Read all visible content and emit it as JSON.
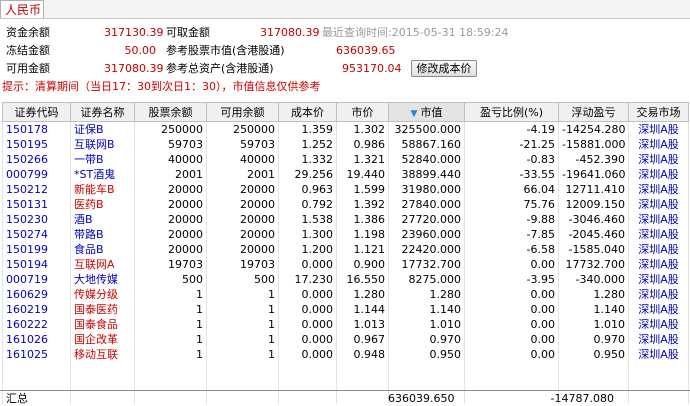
{
  "tab": {
    "label": "人民币"
  },
  "summary": {
    "balance_label": "资金余额",
    "balance": "317130.39",
    "withdrawable_label": "可取金额",
    "withdrawable": "317080.39",
    "last_query": "最近查询时间:2015-05-31 18:59:24",
    "frozen_label": "冻结金额",
    "frozen": "50.00",
    "ref_value_label": "参考股票市值(含港股通)",
    "ref_value": "636039.65",
    "available_label": "可用金额",
    "available": "317080.39",
    "total_assets_label": "参考总资产(含港股通)",
    "total_assets": "953170.04",
    "change_cost_button": "修改成本价"
  },
  "hint": "提示：清算期间（当日17：30到次日1：30），市值信息仅供参考",
  "table": {
    "headers": [
      "证券代码",
      "证券名称",
      "股票余额",
      "可用余额",
      "成本价",
      "市价",
      "市值",
      "盈亏比例(%)",
      "浮动盈亏",
      "交易市场"
    ],
    "rows": [
      [
        "150178",
        "证保B",
        "250000",
        "250000",
        "1.359",
        "1.302",
        "325500.000",
        "-4.19",
        "-14254.280",
        "深圳A股"
      ],
      [
        "150195",
        "互联网B",
        "59703",
        "59703",
        "1.252",
        "0.986",
        "58867.160",
        "-21.25",
        "-15881.000",
        "深圳A股"
      ],
      [
        "150266",
        "一带B",
        "40000",
        "40000",
        "1.332",
        "1.321",
        "52840.000",
        "-0.83",
        "-452.390",
        "深圳A股"
      ],
      [
        "000799",
        "*ST酒鬼",
        "2001",
        "2001",
        "29.256",
        "19.440",
        "38899.440",
        "-33.55",
        "-19641.060",
        "深圳A股"
      ],
      [
        "150212",
        "新能车B",
        "20000",
        "20000",
        "0.963",
        "1.599",
        "31980.000",
        "66.04",
        "12711.410",
        "深圳A股"
      ],
      [
        "150131",
        "医药B",
        "20000",
        "20000",
        "0.792",
        "1.392",
        "27840.000",
        "75.76",
        "12009.150",
        "深圳A股"
      ],
      [
        "150230",
        "酒B",
        "20000",
        "20000",
        "1.538",
        "1.386",
        "27720.000",
        "-9.88",
        "-3046.460",
        "深圳A股"
      ],
      [
        "150274",
        "带路B",
        "20000",
        "20000",
        "1.300",
        "1.198",
        "23960.000",
        "-7.85",
        "-2045.460",
        "深圳A股"
      ],
      [
        "150199",
        "食品B",
        "20000",
        "20000",
        "1.200",
        "1.121",
        "22420.000",
        "-6.58",
        "-1585.040",
        "深圳A股"
      ],
      [
        "150194",
        "互联网A",
        "19703",
        "19703",
        "0.000",
        "0.900",
        "17732.700",
        "0.00",
        "17732.700",
        "深圳A股"
      ],
      [
        "000719",
        "大地传媒",
        "500",
        "500",
        "17.230",
        "16.550",
        "8275.000",
        "-3.95",
        "-340.000",
        "深圳A股"
      ],
      [
        "160629",
        "传媒分级",
        "1",
        "1",
        "0.000",
        "1.280",
        "1.280",
        "0.00",
        "1.280",
        "深圳A股"
      ],
      [
        "160219",
        "国泰医药",
        "1",
        "1",
        "0.000",
        "1.144",
        "1.140",
        "0.00",
        "1.140",
        "深圳A股"
      ],
      [
        "160222",
        "国泰食品",
        "1",
        "1",
        "0.000",
        "1.013",
        "1.010",
        "0.00",
        "1.010",
        "深圳A股"
      ],
      [
        "161026",
        "国企改革",
        "1",
        "1",
        "0.000",
        "0.967",
        "0.970",
        "0.00",
        "0.970",
        "深圳A股"
      ],
      [
        "161025",
        "移动互联",
        "1",
        "1",
        "0.000",
        "0.948",
        "0.950",
        "0.00",
        "0.950",
        "深圳A股"
      ]
    ],
    "row_colors": [
      "blue",
      "blue",
      "blue",
      "blue",
      "red",
      "red",
      "blue",
      "blue",
      "blue",
      "red",
      "blue",
      "red",
      "red",
      "red",
      "red",
      "red"
    ]
  },
  "totals": {
    "label": "汇总",
    "market_value": "636039.650",
    "float_pl": "-14787.080"
  },
  "colors": {
    "red": "#d00000",
    "blue": "#0000c0"
  }
}
